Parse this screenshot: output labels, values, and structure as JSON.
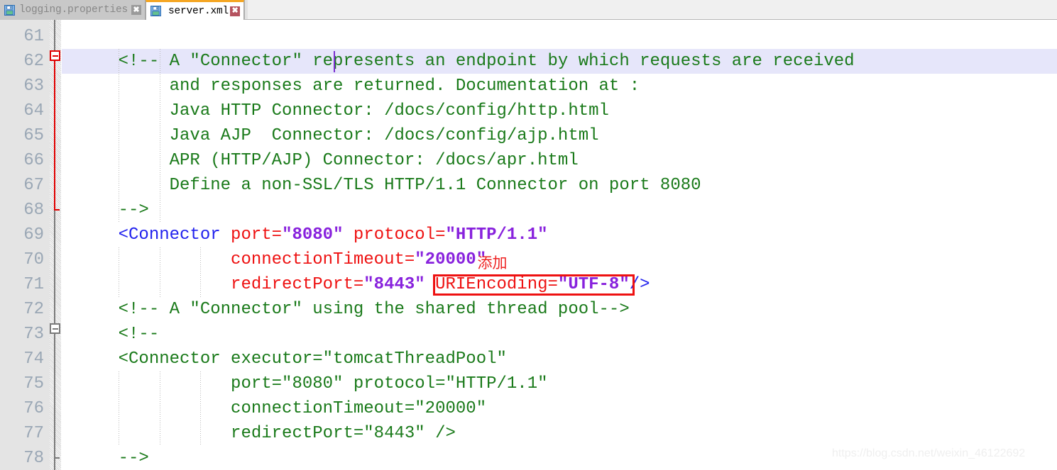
{
  "window": {
    "app": "xml-code-editor"
  },
  "tabs": [
    {
      "label": "logging.properties",
      "icon": "floppy-disk-save-icon",
      "close_glyph": "✖",
      "active": false
    },
    {
      "label": "server.xml",
      "icon": "floppy-disk-save-icon",
      "close_glyph": "✖",
      "active": true
    }
  ],
  "editor": {
    "first_line": 61,
    "line_numbers": [
      "61",
      "62",
      "63",
      "64",
      "65",
      "66",
      "67",
      "68",
      "69",
      "70",
      "71",
      "72",
      "73",
      "74",
      "75",
      "76",
      "77",
      "78"
    ],
    "cursor_line": 62,
    "highlight_line": 62,
    "lines": [
      {
        "no": "61",
        "segments": []
      },
      {
        "no": "62",
        "segments": [
          {
            "text": "    <!-- A \"Connector\" represents an endpoint by which requests are received",
            "cls": "cm"
          }
        ]
      },
      {
        "no": "63",
        "segments": [
          {
            "text": "         and responses are returned. Documentation at :",
            "cls": "cm"
          }
        ]
      },
      {
        "no": "64",
        "segments": [
          {
            "text": "         Java HTTP Connector: /docs/config/http.html",
            "cls": "cm"
          }
        ]
      },
      {
        "no": "65",
        "segments": [
          {
            "text": "         Java AJP  Connector: /docs/config/ajp.html",
            "cls": "cm"
          }
        ]
      },
      {
        "no": "66",
        "segments": [
          {
            "text": "         APR (HTTP/AJP) Connector: /docs/apr.html",
            "cls": "cm"
          }
        ]
      },
      {
        "no": "67",
        "segments": [
          {
            "text": "         Define a non-SSL/TLS HTTP/1.1 Connector on port 8080",
            "cls": "cm"
          }
        ]
      },
      {
        "no": "68",
        "segments": [
          {
            "text": "    -->",
            "cls": "cm"
          }
        ]
      },
      {
        "no": "69",
        "segments": [
          {
            "text": "    <Connector ",
            "cls": "tg"
          },
          {
            "text": "port=",
            "cls": "at"
          },
          {
            "text": "\"8080\"",
            "cls": "vl"
          },
          {
            "text": " protocol=",
            "cls": "at"
          },
          {
            "text": "\"HTTP/1.1\"",
            "cls": "vl"
          }
        ]
      },
      {
        "no": "70",
        "segments": [
          {
            "text": "               connectionTimeout=",
            "cls": "at"
          },
          {
            "text": "\"20000\"",
            "cls": "vl"
          }
        ]
      },
      {
        "no": "71",
        "segments": [
          {
            "text": "               redirectPort=",
            "cls": "at"
          },
          {
            "text": "\"8443\"",
            "cls": "vl"
          },
          {
            "text": " URIEncoding=",
            "cls": "at"
          },
          {
            "text": "\"UTF-8\"",
            "cls": "vl"
          },
          {
            "text": "/>",
            "cls": "tg"
          }
        ]
      },
      {
        "no": "72",
        "segments": [
          {
            "text": "    <!-- A \"Connector\" using the shared thread pool-->",
            "cls": "cm"
          }
        ]
      },
      {
        "no": "73",
        "segments": [
          {
            "text": "    <!--",
            "cls": "cm"
          }
        ]
      },
      {
        "no": "74",
        "segments": [
          {
            "text": "    <Connector executor=\"tomcatThreadPool\"",
            "cls": "cm"
          }
        ]
      },
      {
        "no": "75",
        "segments": [
          {
            "text": "               port=\"8080\" protocol=\"HTTP/1.1\"",
            "cls": "cm"
          }
        ]
      },
      {
        "no": "76",
        "segments": [
          {
            "text": "               connectionTimeout=\"20000\"",
            "cls": "cm"
          }
        ]
      },
      {
        "no": "77",
        "segments": [
          {
            "text": "               redirectPort=\"8443\" />",
            "cls": "cm"
          }
        ]
      },
      {
        "no": "78",
        "segments": [
          {
            "text": "    -->",
            "cls": "cm"
          }
        ]
      }
    ]
  },
  "annotation": {
    "label": "添加",
    "target_text": "URIEncoding=\"UTF-8\"",
    "color": "#ee1111"
  },
  "watermark": {
    "text": "https://blog.csdn.net/weixin_46122692"
  },
  "colors": {
    "comment": "#1a7a1a",
    "tag": "#2222ee",
    "attribute": "#ee1111",
    "value": "#8822dd",
    "active_tab_accent": "#f5a623",
    "line_highlight": "#e6e6fa",
    "gutter_bg": "#e4e4e4",
    "line_number": "#9aa7b5"
  }
}
